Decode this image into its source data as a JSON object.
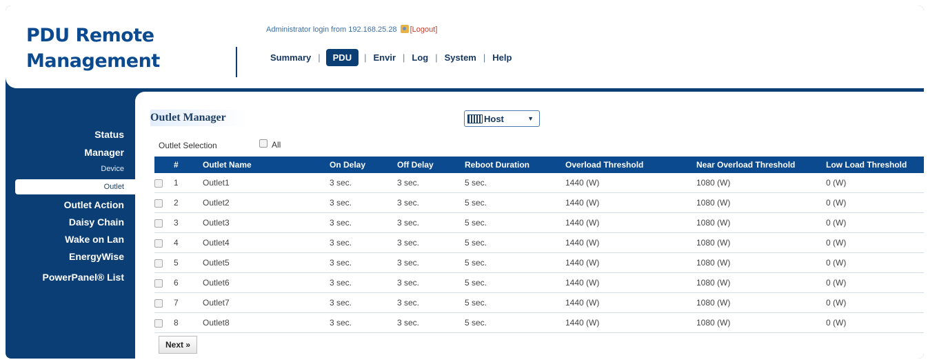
{
  "brand": {
    "line1": "PDU Remote",
    "line2": "Management"
  },
  "login": {
    "text": "Administrator login from 192.168.25.28",
    "logout": "[Logout]"
  },
  "topnav": [
    {
      "label": "Summary",
      "active": false
    },
    {
      "label": "PDU",
      "active": true
    },
    {
      "label": "Envir",
      "active": false
    },
    {
      "label": "Log",
      "active": false
    },
    {
      "label": "System",
      "active": false
    },
    {
      "label": "Help",
      "active": false
    }
  ],
  "sidebar": {
    "status": "Status",
    "manager": "Manager",
    "device": "Device",
    "outlet": "Outlet",
    "outlet_action": "Outlet Action",
    "daisy_chain": "Daisy Chain",
    "wake_on_lan": "Wake on Lan",
    "energywise": "EnergyWise",
    "powerpanel": "PowerPanel® List"
  },
  "panel": {
    "title": "Outlet Manager",
    "host_select": "Host",
    "outlet_selection": "Outlet Selection",
    "all_label": "All",
    "next_button": "Next »"
  },
  "table": {
    "headers": [
      "#",
      "Outlet Name",
      "On Delay",
      "Off Delay",
      "Reboot Duration",
      "Overload Threshold",
      "Near Overload Threshold",
      "Low Load Threshold"
    ],
    "rows": [
      [
        "1",
        "Outlet1",
        "3 sec.",
        "3 sec.",
        "5 sec.",
        "1440 (W)",
        "1080 (W)",
        "0 (W)"
      ],
      [
        "2",
        "Outlet2",
        "3 sec.",
        "3 sec.",
        "5 sec.",
        "1440 (W)",
        "1080 (W)",
        "0 (W)"
      ],
      [
        "3",
        "Outlet3",
        "3 sec.",
        "3 sec.",
        "5 sec.",
        "1440 (W)",
        "1080 (W)",
        "0 (W)"
      ],
      [
        "4",
        "Outlet4",
        "3 sec.",
        "3 sec.",
        "5 sec.",
        "1440 (W)",
        "1080 (W)",
        "0 (W)"
      ],
      [
        "5",
        "Outlet5",
        "3 sec.",
        "3 sec.",
        "5 sec.",
        "1440 (W)",
        "1080 (W)",
        "0 (W)"
      ],
      [
        "6",
        "Outlet6",
        "3 sec.",
        "3 sec.",
        "5 sec.",
        "1440 (W)",
        "1080 (W)",
        "0 (W)"
      ],
      [
        "7",
        "Outlet7",
        "3 sec.",
        "3 sec.",
        "5 sec.",
        "1440 (W)",
        "1080 (W)",
        "0 (W)"
      ],
      [
        "8",
        "Outlet8",
        "3 sec.",
        "3 sec.",
        "5 sec.",
        "1440 (W)",
        "1080 (W)",
        "0 (W)"
      ]
    ]
  },
  "colors": {
    "navy": "#0b3e74",
    "header_blue": "#0b4a8f",
    "logout_red": "#c83a2a"
  }
}
